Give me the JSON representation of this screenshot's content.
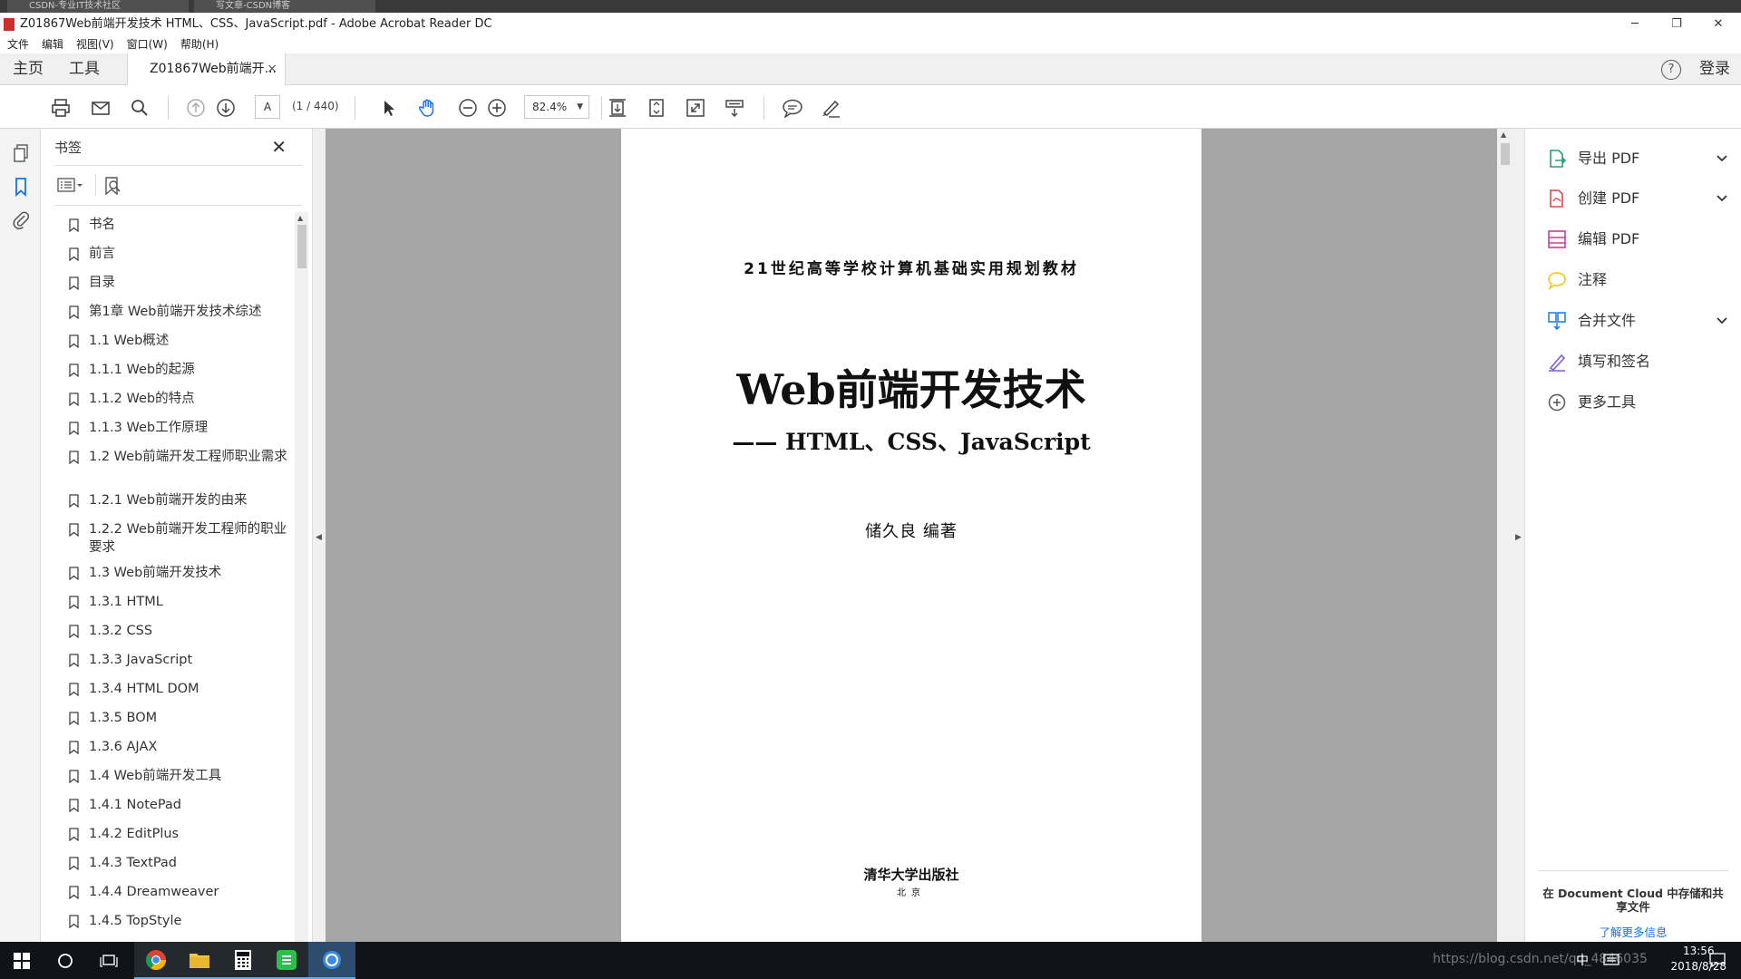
{
  "browser_tabs": [
    "CSDN-专业IT技术社区",
    "写文章-CSDN博客"
  ],
  "window": {
    "title": "Z01867Web前端开发技术  HTML、CSS、JavaScript.pdf - Adobe Acrobat Reader DC",
    "minimize": "─",
    "restore": "❐",
    "close": "✕"
  },
  "menu": [
    "文件",
    "编辑",
    "视图(V)",
    "窗口(W)",
    "帮助(H)"
  ],
  "tabs": {
    "home": "主页",
    "tools": "工具",
    "document": "Z01867Web前端开...",
    "close": "×",
    "help": "?",
    "login": "登录"
  },
  "toolbar": {
    "page_box": "A",
    "page_count": "(1 / 440)",
    "zoom": "82.4%"
  },
  "bookmarks": {
    "header": "书签",
    "close": "✕",
    "items": [
      "书名",
      "前言",
      "目录",
      "第1章  Web前端开发技术综述",
      "1.1  Web概述",
      "1.1.1  Web的起源",
      "1.1.2  Web的特点",
      "1.1.3  Web工作原理",
      "1.2  Web前端开发工程师职业需求",
      "1.2.1  Web前端开发的由来",
      "1.2.2  Web前端开发工程师的职业要求",
      "1.3  Web前端开发技术",
      "1.3.1  HTML",
      "1.3.2  CSS",
      "1.3.3  JavaScript",
      "1.3.4  HTML DOM",
      "1.3.5  BOM",
      "1.3.6  AJAX",
      "1.4  Web前端开发工具",
      "1.4.1 NotePad",
      "1.4.2  EditPlus",
      "1.4.3 TextPad",
      "1.4.4  Dreamweaver",
      "1.4.5  TopStyle"
    ]
  },
  "page": {
    "series": "21世纪高等学校计算机基础实用规划教材",
    "title": "Web前端开发技术",
    "subtitle": "—— HTML、CSS、JavaScript",
    "author": "储久良  编著",
    "publisher": "清华大学出版社",
    "city": "北京"
  },
  "tools": [
    {
      "label": "导出 PDF",
      "icon": "export-pdf-icon",
      "color": "#2d9d78",
      "expandable": true
    },
    {
      "label": "创建 PDF",
      "icon": "create-pdf-icon",
      "color": "#e34850",
      "expandable": true
    },
    {
      "label": "编辑 PDF",
      "icon": "edit-pdf-icon",
      "color": "#d83790",
      "expandable": false
    },
    {
      "label": "注释",
      "icon": "comment-icon",
      "color": "#f5c518",
      "expandable": false
    },
    {
      "label": "合并文件",
      "icon": "combine-files-icon",
      "color": "#2680eb",
      "expandable": true
    },
    {
      "label": "填写和签名",
      "icon": "fill-sign-icon",
      "color": "#7e5cd6",
      "expandable": false
    },
    {
      "label": "更多工具",
      "icon": "more-tools-icon",
      "color": "#555555",
      "expandable": false
    }
  ],
  "cloud": {
    "text": "在 Document Cloud 中存储和共享文件",
    "link": "了解更多信息"
  },
  "taskbar": {
    "time": "13:56",
    "date": "2018/8/28",
    "ime": "中",
    "watermark": "https://blog.csdn.net/qq_4846035"
  },
  "colors": {
    "accent": "#1473e6",
    "doc_bg": "#a6a6a6",
    "taskbar": "#101418"
  }
}
